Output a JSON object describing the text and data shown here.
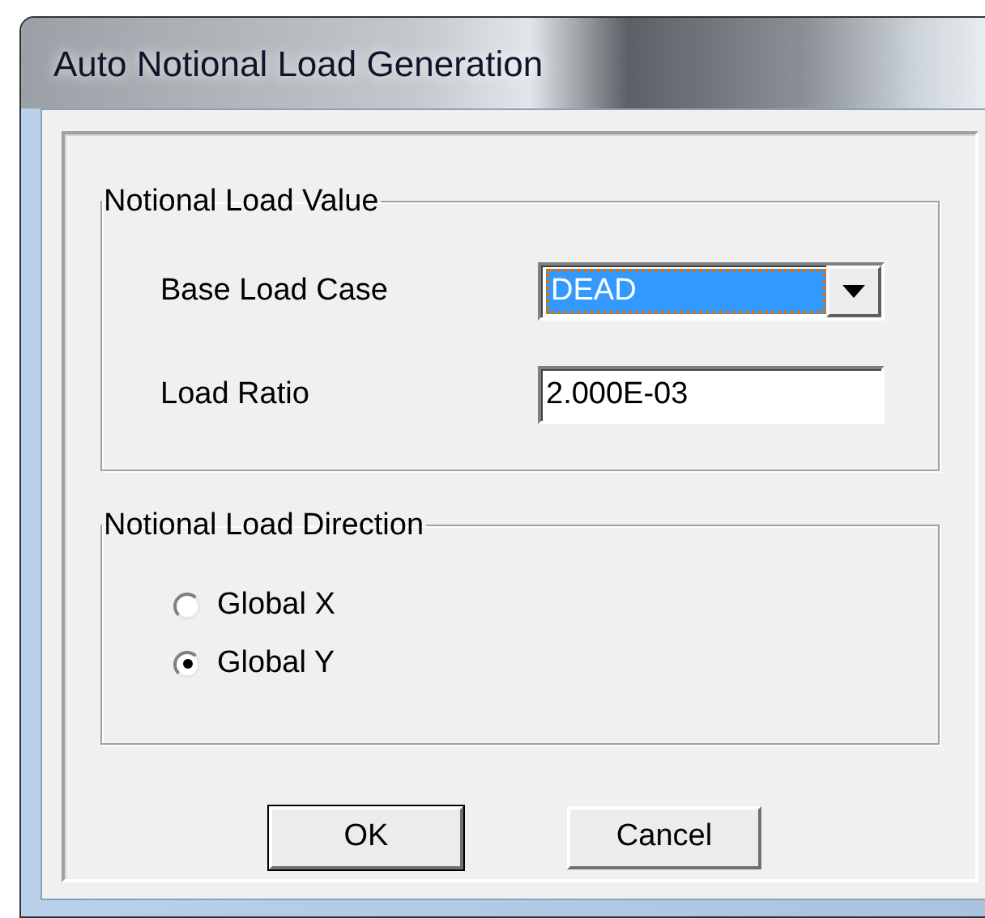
{
  "window": {
    "title": "Auto Notional Load Generation"
  },
  "groups": [
    {
      "title": "Notional Load Value",
      "fields": [
        {
          "kind": "dropdown",
          "label": "Base Load Case",
          "value": "DEAD",
          "focused": true
        },
        {
          "kind": "text",
          "label": "Load Ratio",
          "value": "2.000E-03",
          "focused": false
        }
      ]
    },
    {
      "title": "Notional Load Direction",
      "options": [
        {
          "label": "Global X",
          "selected": false
        },
        {
          "label": "Global Y",
          "selected": true
        }
      ]
    }
  ],
  "buttons": [
    {
      "label": "OK",
      "default": true
    },
    {
      "label": "Cancel",
      "default": false
    }
  ]
}
